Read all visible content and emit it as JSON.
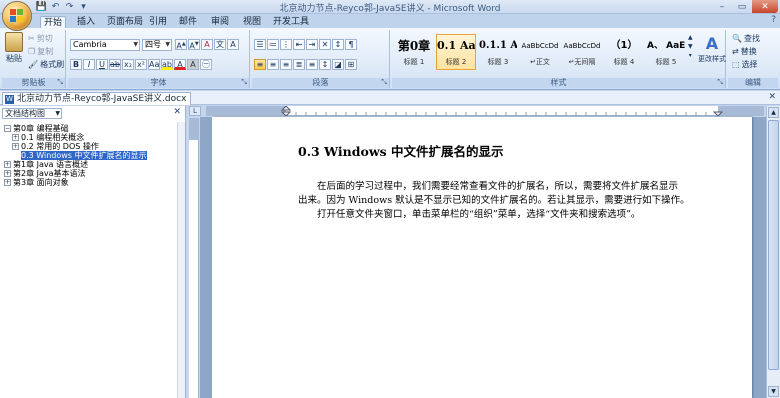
{
  "window": {
    "title": "北京动力节点-Reyco郭-JavaSE讲义 - Microsoft Word",
    "controls": {
      "minimize": "–",
      "restore": "▭",
      "close": "✕"
    }
  },
  "ribbon_tabs": [
    "开始",
    "插入",
    "页面布局",
    "引用",
    "邮件",
    "审阅",
    "视图",
    "开发工具"
  ],
  "clipboard": {
    "paste_label": "粘贴",
    "cut_label": "剪切",
    "copy_label": "复制",
    "format_painter_label": "格式刷",
    "group_label": "剪贴板"
  },
  "font": {
    "font_name": "Cambria",
    "font_size": "四号",
    "group_label": "字体"
  },
  "paragraph": {
    "group_label": "段落"
  },
  "styles": {
    "group_label": "样式",
    "items": [
      {
        "sample": "第0章",
        "name": "标题 1",
        "selected": false
      },
      {
        "sample": "0.1 Aal",
        "name": "标题 2",
        "selected": true
      },
      {
        "sample": "0.1.1 A",
        "name": "标题 3",
        "selected": false
      },
      {
        "sample": "AaBbCcDd",
        "name": "↵正文",
        "selected": false
      },
      {
        "sample": "AaBbCcDd",
        "name": "↵无间隔",
        "selected": false
      },
      {
        "sample": "（1）",
        "name": "标题 4",
        "selected": false
      },
      {
        "sample": "A、 AaE",
        "name": "标题 5",
        "selected": false
      }
    ],
    "change_styles_label": "更改样式"
  },
  "editing": {
    "group_label": "编辑",
    "find_label": "查找",
    "replace_label": "替换",
    "select_label": "选择"
  },
  "document_tab": {
    "label": "北京动力节点-Reyco郭-JavaSE讲义.docx"
  },
  "nav_pane": {
    "view_label": "文档结构图",
    "tree": [
      {
        "level": 0,
        "expander": "⊟",
        "label": "第0章   编程基础",
        "selected": false
      },
      {
        "level": 1,
        "expander": "⊞",
        "label": "0.1 编程相关概念",
        "selected": false
      },
      {
        "level": 1,
        "expander": "⊞",
        "label": "0.2 常用的 DOS 操作",
        "selected": false
      },
      {
        "level": 1,
        "expander": "",
        "label": "0.3 Windows 中文件扩展名的显示",
        "selected": true
      },
      {
        "level": 0,
        "expander": "⊞",
        "label": "第1章   Java 语言概述",
        "selected": false
      },
      {
        "level": 0,
        "expander": "⊞",
        "label": "第2章   Java基本语法",
        "selected": false
      },
      {
        "level": 0,
        "expander": "⊞",
        "label": "第3章   面向对象",
        "selected": false
      }
    ]
  },
  "document": {
    "heading": "0.3 Windows 中文件扩展名的显示",
    "paragraph_lines": [
      "在后面的学习过程中，我们需要经常查看文件的扩展名，所以，需要将文件扩展名显示",
      "出来。因为 Windows 默认是不显示已知的文件扩展名的。若让其显示，需要进行如下操作。",
      "打开任意文件夹窗口，单击菜单栏的“组织”菜单，选择“文件夹和搜索选项”。"
    ]
  },
  "colors": {
    "accent": "#2f66c9",
    "ribbon_bg": "#dde9f7",
    "frame": "#c5d6ec"
  }
}
